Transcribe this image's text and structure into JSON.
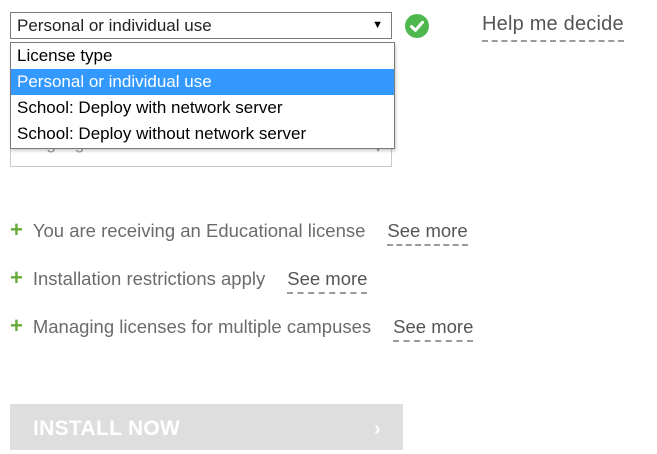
{
  "license_select": {
    "value": "Personal or individual use",
    "caret": "▼",
    "options": [
      {
        "label": "License type",
        "selected": false
      },
      {
        "label": "Personal or individual use",
        "selected": true
      },
      {
        "label": "School: Deploy with network server",
        "selected": false
      },
      {
        "label": "School: Deploy without network server",
        "selected": false
      }
    ],
    "status_icon": "check-circle-icon",
    "status_color": "#4eb74e"
  },
  "help_link": "Help me decide",
  "language_select": {
    "placeholder": "Language",
    "caret": "▼"
  },
  "info_items": [
    {
      "icon": "plus-icon",
      "text": "You are receiving an Educational license",
      "link": "See more"
    },
    {
      "icon": "plus-icon",
      "text": "Installation restrictions apply",
      "link": "See more"
    },
    {
      "icon": "plus-icon",
      "text": "Managing licenses for multiple campuses",
      "link": "See more"
    }
  ],
  "install_button": {
    "label": "INSTALL NOW",
    "chevron": "›",
    "enabled": false
  }
}
